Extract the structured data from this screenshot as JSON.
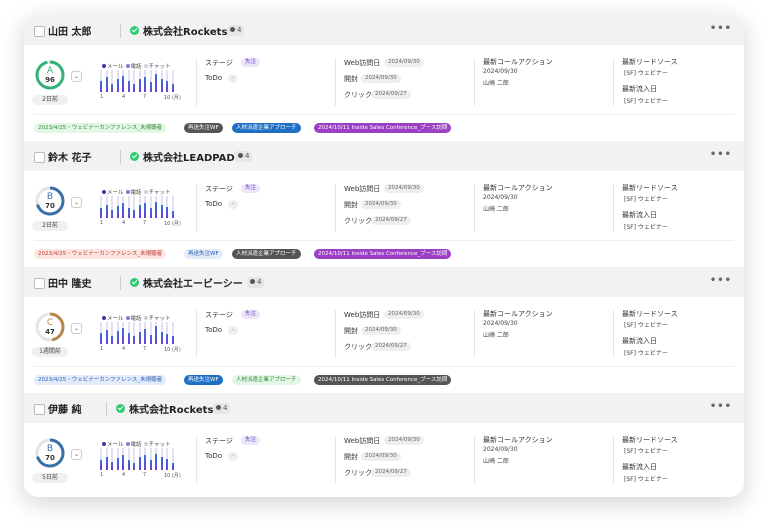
{
  "labels": {
    "stage": "ステージ",
    "todo": "ToDo",
    "web_visit": "Web訪問日",
    "open": "開封",
    "click": "クリック",
    "last_call": "最新コールアクション",
    "lead_source": "最新リードソース",
    "inflow": "最新流入日",
    "legend_mail": "メール",
    "legend_phone": "電話",
    "legend_chat": "チャット",
    "more": "•••"
  },
  "chart_ticks": [
    "1",
    "4",
    "7",
    "10 (月)"
  ],
  "colors": {
    "purple": "#6a3fd6",
    "blue": "#3b6fd9",
    "green_check": "#2ecc71"
  },
  "cards": [
    {
      "name": "山田 太郎",
      "company": "株式会社Rockets",
      "count": "4",
      "grade": "A",
      "score": "96",
      "score_pct": 0.96,
      "grade_color": "#33b277",
      "ago": "2日前",
      "stage": "失注",
      "todo": "-",
      "web_date": "2024/09/30",
      "open_date": "2024/09/30",
      "click_date": "2024/09/27",
      "call_date": "2024/09/30",
      "call_person": "山崎 二郎",
      "lead_source": "[SF] ウェビナー",
      "inflow_source": "[SF] ウェビナー",
      "bars": [
        0.5,
        0.7,
        0.35,
        0.6,
        0.75,
        0.5,
        0.35,
        0.6,
        0.7,
        0.45,
        0.8,
        0.6,
        0.5,
        0.35
      ],
      "tags": [
        {
          "text": "2023/4/25・ウェビナーカンファレンス_未視聴者",
          "bg": "#e4f6e5",
          "fg": "#2f8a3a"
        },
        {
          "text": "再送失注WF",
          "bg": "#555555",
          "fg": "#ffffff"
        },
        {
          "text": "人材派遣企業アプローチ",
          "bg": "#1f6fc4",
          "fg": "#ffffff"
        },
        {
          "text": "2024/10/11 Inside Sales Conference_ブース訪問",
          "bg": "#9b3fc4",
          "fg": "#ffffff"
        }
      ]
    },
    {
      "name": "鈴木 花子",
      "company": "株式会社LEADPAD",
      "count": "4",
      "grade": "B",
      "score": "70",
      "score_pct": 0.7,
      "grade_color": "#3b6fa8",
      "ago": "2日前",
      "stage": "失注",
      "todo": "-",
      "web_date": "2024/09/30",
      "open_date": "2024/09/30",
      "click_date": "2024/09/27",
      "call_date": "2024/09/30",
      "call_person": "山崎 二郎",
      "lead_source": "[SF] ウェビナー",
      "inflow_source": "[SF] ウェビナー",
      "bars": [
        0.45,
        0.6,
        0.35,
        0.55,
        0.7,
        0.45,
        0.35,
        0.6,
        0.7,
        0.45,
        0.75,
        0.6,
        0.5,
        0.3
      ],
      "tags": [
        {
          "text": "2023/4/25・ウェビナーカンファレンス_未視聴者",
          "bg": "#fbe6e4",
          "fg": "#c0392b"
        },
        {
          "text": "再送失注WF",
          "bg": "#e3ecfa",
          "fg": "#2a5db0"
        },
        {
          "text": "人材派遣企業アプローチ",
          "bg": "#555555",
          "fg": "#ffffff"
        },
        {
          "text": "2024/10/11 Inside Sales Conference_ブース訪問",
          "bg": "#9b3fc4",
          "fg": "#ffffff"
        }
      ]
    },
    {
      "name": "田中 隆史",
      "company": "株式会社エービーシー",
      "count": "4",
      "grade": "C",
      "score": "47",
      "score_pct": 0.47,
      "grade_color": "#b8884a",
      "ago": "1週間前",
      "stage": "失注",
      "todo": "-",
      "web_date": "2024/09/30",
      "open_date": "2024/09/30",
      "click_date": "2024/09/27",
      "call_date": "2024/09/30",
      "call_person": "山崎 二郎",
      "lead_source": "[SF] ウェビナー",
      "inflow_source": "[SF] ウェビナー",
      "bars": [
        0.5,
        0.65,
        0.35,
        0.6,
        0.75,
        0.5,
        0.35,
        0.55,
        0.7,
        0.4,
        0.8,
        0.55,
        0.45,
        0.35
      ],
      "tags": [
        {
          "text": "2023/4/25・ウェビナーカンファレンス_未視聴者",
          "bg": "#e3ecfa",
          "fg": "#2a5db0"
        },
        {
          "text": "再送失注WF",
          "bg": "#1f6fc4",
          "fg": "#ffffff"
        },
        {
          "text": "人材派遣企業アプローチ",
          "bg": "#e4f6e5",
          "fg": "#2f8a3a"
        },
        {
          "text": "2024/10/11 Inside Sales Conference_ブース訪問",
          "bg": "#555555",
          "fg": "#ffffff"
        }
      ]
    },
    {
      "name": "伊藤 純",
      "company": "株式会社Rockets",
      "count": "4",
      "grade": "B",
      "score": "70",
      "score_pct": 0.7,
      "grade_color": "#3b6fa8",
      "ago": "5日前",
      "stage": "失注",
      "todo": "-",
      "web_date": "2024/09/30",
      "open_date": "2024/09/30",
      "click_date": "2024/09/27",
      "call_date": "2024/09/30",
      "call_person": "山崎 二郎",
      "lead_source": "[SF] ウェビナー",
      "inflow_source": "[SF] ウェビナー",
      "bars": [
        0.45,
        0.6,
        0.35,
        0.55,
        0.7,
        0.45,
        0.3,
        0.6,
        0.7,
        0.45,
        0.75,
        0.6,
        0.5,
        0.3
      ],
      "tags": []
    }
  ]
}
